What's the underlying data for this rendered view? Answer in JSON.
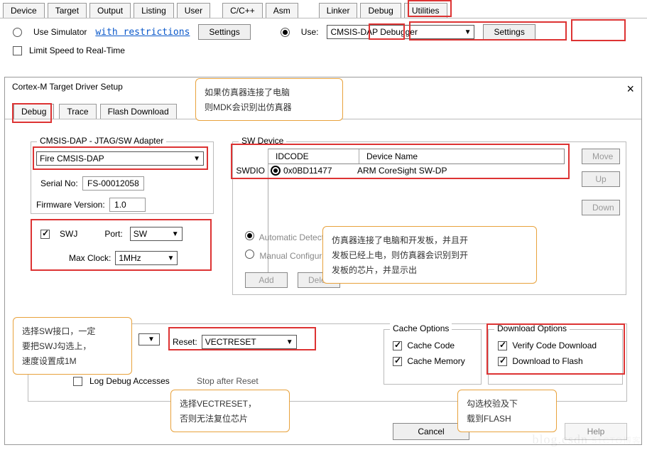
{
  "topTabs": [
    "Device",
    "Target",
    "Output",
    "Listing",
    "User",
    "C/C++",
    "Asm",
    "Linker",
    "Debug",
    "Utilities"
  ],
  "row1": {
    "useSimulator": "Use Simulator",
    "withRestrictions": "with restrictions",
    "settings1": "Settings",
    "useLabel": "Use:",
    "debuggerSelected": "CMSIS-DAP Debugger",
    "settings2": "Settings"
  },
  "row2": {
    "limitSpeed": "Limit Speed to Real-Time"
  },
  "dialog": {
    "title": "Cortex-M Target Driver Setup",
    "close": "×",
    "tabs": [
      "Debug",
      "Trace",
      "Flash Download"
    ],
    "adapter": {
      "group": "CMSIS-DAP - JTAG/SW Adapter",
      "device": "Fire CMSIS-DAP",
      "serialLabel": "Serial No:",
      "serial": "FS-00012058",
      "fwLabel": "Firmware Version:",
      "fw": "1.0",
      "swj": "SWJ",
      "portLabel": "Port:",
      "port": "SW",
      "maxClockLabel": "Max Clock:",
      "maxClock": "1MHz"
    },
    "sw": {
      "group": "SW Device",
      "idcode": "IDCODE",
      "dname": "Device Name",
      "swdio": "SWDIO",
      "idval": "0x0BD11477",
      "nameval": "ARM CoreSight SW-DP",
      "auto": "Automatic Detection",
      "manual": "Manual Configuration",
      "add": "Add",
      "delete": "Delete",
      "move": "Move",
      "up": "Up",
      "down": "Down"
    },
    "lower": {
      "resetLabel": "Reset:",
      "reset": "VECTRESET",
      "logDebug": "Log Debug Accesses",
      "stopAfterReset": "Stop after Reset",
      "cacheGroup": "Cache Options",
      "cacheCode": "Cache Code",
      "cacheMem": "Cache Memory",
      "dlGroup": "Download Options",
      "verify": "Verify Code Download",
      "dlflash": "Download to Flash"
    },
    "buttons": {
      "cancel": "Cancel",
      "help": "Help"
    }
  },
  "callouts": {
    "c1": "如果仿真器连接了电脑\n则MDK会识别出仿真器",
    "c2": "仿真器连接了电脑和开发板，并且开\n发板已经上电，则仿真器会识别到开\n发板的芯片，并显示出",
    "c3": "选择SW接口，一定\n要把SWJ勾选上，\n速度设置成1M",
    "c4": "选择VECTRESET，\n否则无法复位芯片",
    "c5": "勾选校验及下\n载到FLASH"
  }
}
